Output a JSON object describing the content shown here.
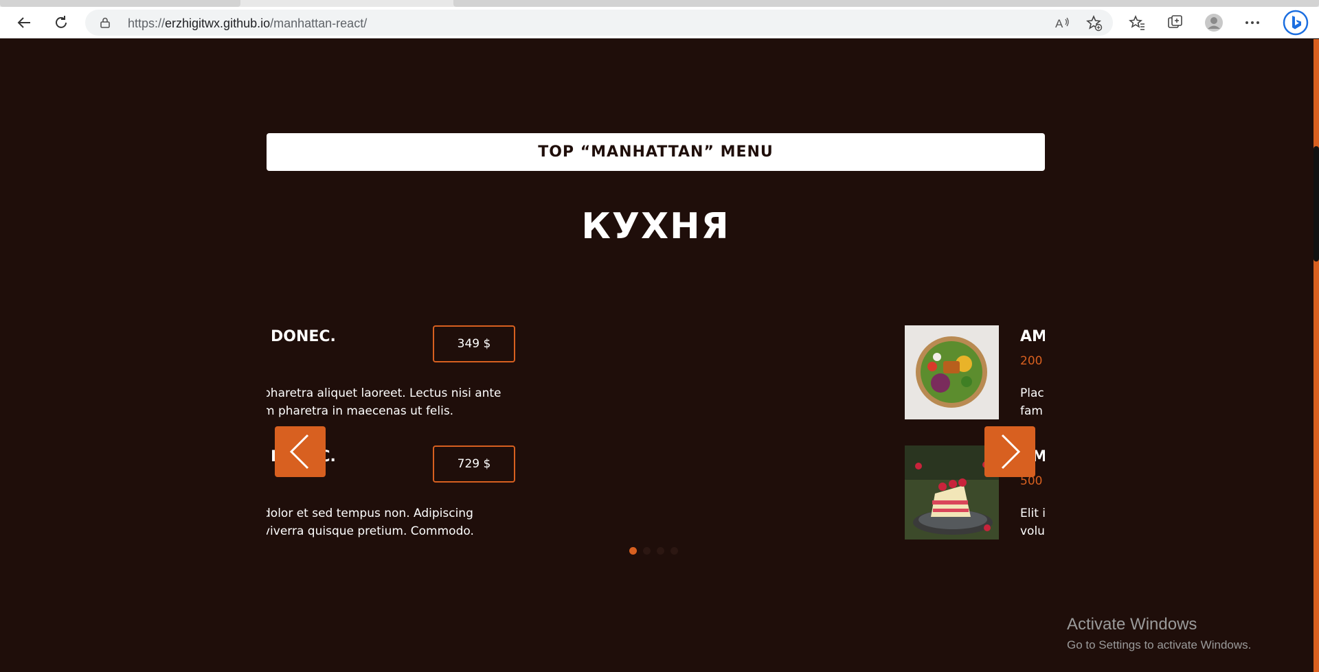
{
  "browser": {
    "url_prefix": "https://",
    "url_host": "erzhigitwx.github.io",
    "url_path": "/manhattan-react/"
  },
  "page": {
    "menu_button_label": "TOP “MANHATTAN” MENU",
    "section_title": "КУХНЯ",
    "items": [
      {
        "title": "DONEC.",
        "price": "349 $",
        "desc_line1": "pharetra aliquet laoreet. Lectus nisi ante",
        "desc_line2": "m pharetra in maecenas ut felis."
      },
      {
        "title": "DONEC.",
        "price": "729 $",
        "desc_line1": "dolor et sed tempus non. Adipiscing",
        "desc_line2": "viverra quisque pretium. Commodo."
      },
      {
        "title": "AM",
        "weight": "200",
        "desc_line1": "Plac",
        "desc_line2": "fam"
      },
      {
        "title": "AM",
        "weight": "500",
        "desc_line1": "Elit in",
        "desc_line2": "volu"
      }
    ],
    "slider": {
      "dot_count": 4,
      "active_index": 0
    }
  },
  "watermark": {
    "title": "Activate Windows",
    "subtitle": "Go to Settings to activate Windows."
  },
  "colors": {
    "accent": "#d86020",
    "background": "#1f0e0a"
  }
}
